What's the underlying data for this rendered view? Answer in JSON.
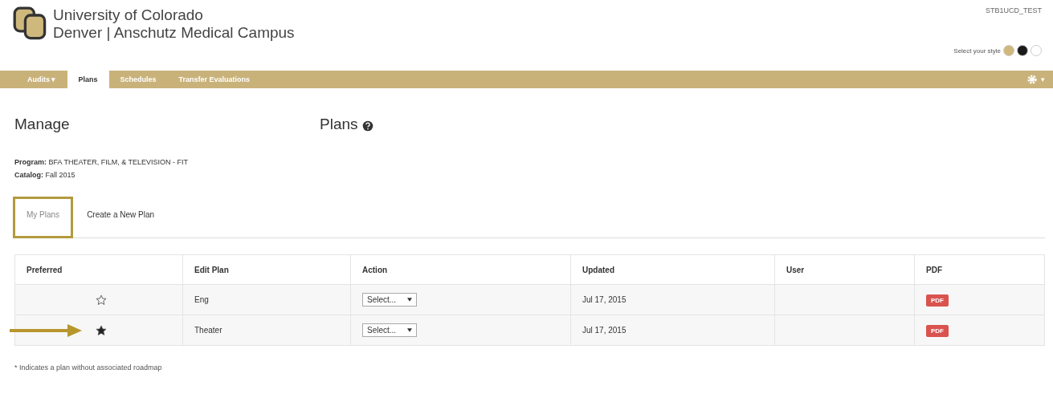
{
  "header": {
    "university_line": "University of Colorado",
    "campus_line": "Denver | Anschutz Medical Campus",
    "user": "STB1UCD_TEST",
    "style_label": "Select your style",
    "style_swatches": [
      {
        "color": "#cfb87c"
      },
      {
        "color": "#1a1a1a"
      },
      {
        "color": "#ffffff"
      }
    ]
  },
  "nav": {
    "items": [
      {
        "label": "Audits ▾",
        "selected": false
      },
      {
        "label": "Plans",
        "selected": true
      },
      {
        "label": "Schedules",
        "selected": false
      },
      {
        "label": "Transfer Evaluations",
        "selected": false
      }
    ],
    "settings_caret": "▾"
  },
  "page": {
    "title_left": "Manage",
    "title_right": "Plans",
    "program_label": "Program:",
    "program_value": "BFA THEATER, FILM, & TELEVISION - FIT",
    "catalog_label": "Catalog:",
    "catalog_value": "Fall 2015"
  },
  "tabs": [
    {
      "label": "My Plans",
      "selected": true
    },
    {
      "label": "Create a New Plan",
      "selected": false
    }
  ],
  "table": {
    "columns": [
      "Preferred",
      "Edit Plan",
      "Action",
      "Updated",
      "User",
      "PDF"
    ],
    "rows": [
      {
        "preferred": false,
        "highlighted": false,
        "plan": "Eng",
        "action": "Select...",
        "updated": "Jul 17, 2015",
        "user": "",
        "pdf": "PDF"
      },
      {
        "preferred": true,
        "highlighted": true,
        "plan": "Theater",
        "action": "Select...",
        "updated": "Jul 17, 2015",
        "user": "",
        "pdf": "PDF"
      }
    ]
  },
  "footnote": "* Indicates a plan without associated roadmap"
}
